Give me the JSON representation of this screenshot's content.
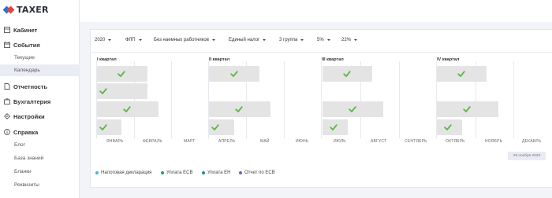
{
  "app": {
    "logo_text": "TAXER",
    "brand_blue": "#2f6fd6",
    "brand_red": "#e0453a"
  },
  "sidebar": {
    "items": [
      {
        "label": "Кабинет",
        "icon": "cabinet-icon"
      },
      {
        "label": "События",
        "icon": "calendar-icon"
      },
      {
        "label": "Отчетность",
        "icon": "document-icon"
      },
      {
        "label": "Бухгалтерия",
        "icon": "briefcase-icon"
      },
      {
        "label": "Настройки",
        "icon": "gear-icon"
      },
      {
        "label": "Справка",
        "icon": "info-icon"
      }
    ],
    "events_sub": [
      {
        "label": "Текущие",
        "active": false
      },
      {
        "label": "Календарь",
        "active": true
      }
    ],
    "help_sub": [
      {
        "label": "Блог"
      },
      {
        "label": "База знаний"
      },
      {
        "label": "Бланки"
      },
      {
        "label": "Реквизиты"
      }
    ]
  },
  "filters": [
    {
      "value": "2020"
    },
    {
      "value": "ФЛП"
    },
    {
      "value": "Без наемных работников"
    },
    {
      "value": "Единый налог"
    },
    {
      "value": "3 группа"
    },
    {
      "value": "5%"
    },
    {
      "value": "22%"
    }
  ],
  "calendar": {
    "quarters": [
      "I квартал",
      "II квартал",
      "III квартал",
      "IV квартал"
    ],
    "months": [
      "ЯНВАРЬ",
      "ФЕВРАЛЬ",
      "МАРТ",
      "АПРЕЛЬ",
      "МАЙ",
      "ИЮНЬ",
      "ИЮЛЬ",
      "АВГУСТ",
      "СЕНТЯБРЬ",
      "ОКТЯБРЬ",
      "НОЯБРЬ",
      "ДЕКАБРЬ"
    ],
    "today_label": "28 ноября 2020",
    "check_color": "#5bb544",
    "bar_color": "#e4e4e4"
  },
  "legend": [
    {
      "label": "Налоговая декларация",
      "color": "#42b8d4"
    },
    {
      "label": "Уплата ЕСВ",
      "color": "#1aa36e"
    },
    {
      "label": "Уплата ЕН",
      "color": "#1e8f8f"
    },
    {
      "label": "Отчет по ЕСВ",
      "color": "#6c5fc9"
    }
  ]
}
